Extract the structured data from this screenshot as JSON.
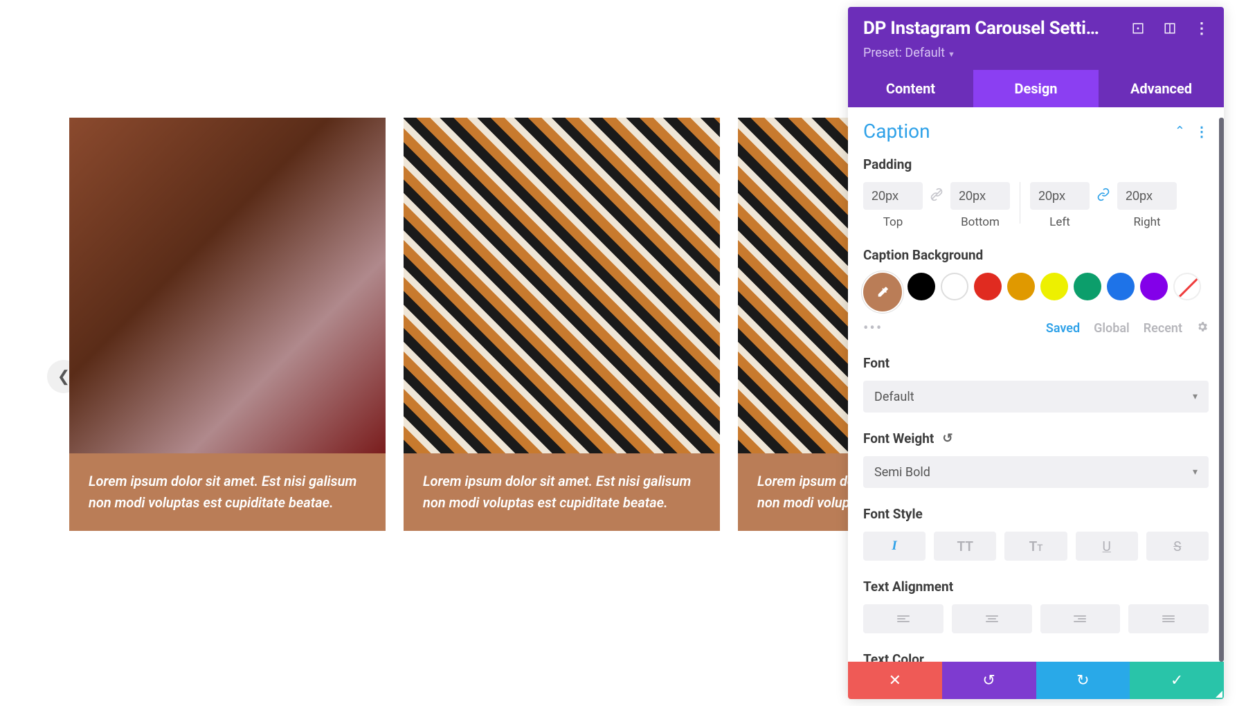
{
  "carousel": {
    "caption_text": "Lorem ipsum dolor sit amet. Est nisi galisum non modi voluptas est cupiditate beatae.",
    "cards": [
      {
        "caption_key": "carousel.caption_text",
        "img_class": "img1"
      },
      {
        "caption_key": "carousel.caption_text",
        "img_class": "img2"
      },
      {
        "caption_key": "carousel.caption_text",
        "img_class": "img3"
      }
    ]
  },
  "panel": {
    "title": "DP Instagram Carousel Setti…",
    "preset_label": "Preset: Default",
    "tabs": {
      "content": "Content",
      "design": "Design",
      "advanced": "Advanced",
      "active": "design"
    },
    "section_title": "Caption",
    "padding": {
      "label": "Padding",
      "top": {
        "value": "20px",
        "label": "Top"
      },
      "bottom": {
        "value": "20px",
        "label": "Bottom"
      },
      "left": {
        "value": "20px",
        "label": "Left"
      },
      "right": {
        "value": "20px",
        "label": "Right"
      },
      "link_tb": false,
      "link_lr": true
    },
    "caption_bg": {
      "label": "Caption Background",
      "swatches": [
        "#000000",
        "#ffffff",
        "#e02b20",
        "#edb059",
        "#f4e425",
        "#0c9e6b",
        "#1e73be",
        "#8300e9"
      ],
      "picker_color": "#ba7d57",
      "tabs": {
        "saved": "Saved",
        "global": "Global",
        "recent": "Recent"
      }
    },
    "font": {
      "label": "Font",
      "value": "Default"
    },
    "font_weight": {
      "label": "Font Weight",
      "value": "Semi Bold"
    },
    "font_style": {
      "label": "Font Style",
      "active": "italic"
    },
    "text_align": {
      "label": "Text Alignment"
    },
    "text_color": {
      "label": "Text Color"
    }
  }
}
